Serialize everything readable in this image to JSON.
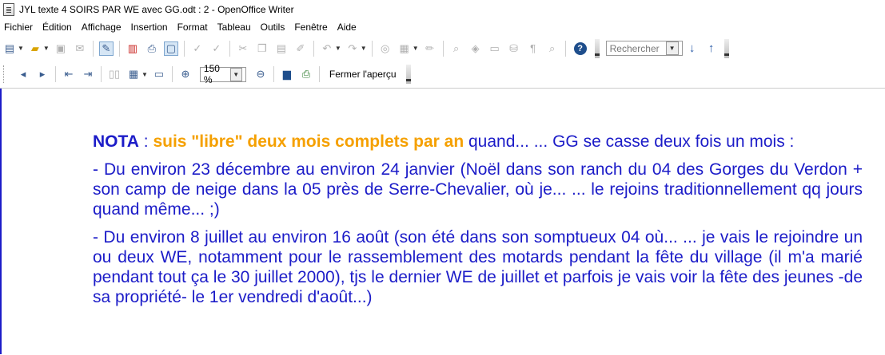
{
  "window": {
    "title": "JYL  texte 4 SOIRS PAR WE avec GG.odt : 2 - OpenOffice Writer"
  },
  "menu": [
    "Fichier",
    "Édition",
    "Affichage",
    "Insertion",
    "Format",
    "Tableau",
    "Outils",
    "Fenêtre",
    "Aide"
  ],
  "toolbar": {
    "search_placeholder": "Rechercher",
    "zoom": "150 %",
    "close_preview": "Fermer l'aperçu"
  },
  "document": {
    "p1_nota": "NOTA",
    "p1_colon": " : ",
    "p1_orange": "suis \"libre\" deux mois complets par an",
    "p1_rest": " quand... ... GG se casse deux fois un mois :",
    "p2": "- Du environ 23 décembre au environ 24 janvier (Noël dans son ranch du 04 des Gorges du Verdon + son camp de neige dans la 05 près de Serre-Chevalier, où je... ... le rejoins traditionnellement qq jours quand même... ;)",
    "p3": "- Du environ 8 juillet au environ 16 août (son été dans son somptueux 04 où... ... je vais le rejoindre un ou deux WE, notamment pour le rassemblement des motards pendant la fête du village (il m'a marié pendant tout ça le 30 juillet 2000), tjs le dernier WE de juillet et parfois je vais voir la fête des jeunes -de sa propriété- le 1er vendredi d'août...)"
  },
  "colors": {
    "text_blue": "#1c1cc8",
    "highlight_orange": "#f5a000"
  }
}
